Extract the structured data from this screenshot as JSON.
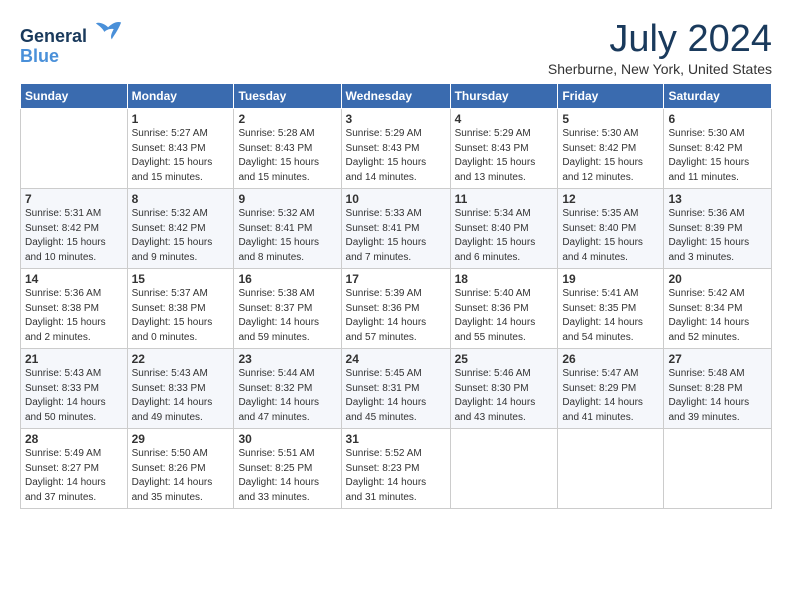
{
  "header": {
    "logo_line1": "General",
    "logo_line2": "Blue",
    "month_title": "July 2024",
    "location": "Sherburne, New York, United States"
  },
  "weekdays": [
    "Sunday",
    "Monday",
    "Tuesday",
    "Wednesday",
    "Thursday",
    "Friday",
    "Saturday"
  ],
  "weeks": [
    [
      {
        "day": "",
        "info": ""
      },
      {
        "day": "1",
        "info": "Sunrise: 5:27 AM\nSunset: 8:43 PM\nDaylight: 15 hours\nand 15 minutes."
      },
      {
        "day": "2",
        "info": "Sunrise: 5:28 AM\nSunset: 8:43 PM\nDaylight: 15 hours\nand 15 minutes."
      },
      {
        "day": "3",
        "info": "Sunrise: 5:29 AM\nSunset: 8:43 PM\nDaylight: 15 hours\nand 14 minutes."
      },
      {
        "day": "4",
        "info": "Sunrise: 5:29 AM\nSunset: 8:43 PM\nDaylight: 15 hours\nand 13 minutes."
      },
      {
        "day": "5",
        "info": "Sunrise: 5:30 AM\nSunset: 8:42 PM\nDaylight: 15 hours\nand 12 minutes."
      },
      {
        "day": "6",
        "info": "Sunrise: 5:30 AM\nSunset: 8:42 PM\nDaylight: 15 hours\nand 11 minutes."
      }
    ],
    [
      {
        "day": "7",
        "info": "Sunrise: 5:31 AM\nSunset: 8:42 PM\nDaylight: 15 hours\nand 10 minutes."
      },
      {
        "day": "8",
        "info": "Sunrise: 5:32 AM\nSunset: 8:42 PM\nDaylight: 15 hours\nand 9 minutes."
      },
      {
        "day": "9",
        "info": "Sunrise: 5:32 AM\nSunset: 8:41 PM\nDaylight: 15 hours\nand 8 minutes."
      },
      {
        "day": "10",
        "info": "Sunrise: 5:33 AM\nSunset: 8:41 PM\nDaylight: 15 hours\nand 7 minutes."
      },
      {
        "day": "11",
        "info": "Sunrise: 5:34 AM\nSunset: 8:40 PM\nDaylight: 15 hours\nand 6 minutes."
      },
      {
        "day": "12",
        "info": "Sunrise: 5:35 AM\nSunset: 8:40 PM\nDaylight: 15 hours\nand 4 minutes."
      },
      {
        "day": "13",
        "info": "Sunrise: 5:36 AM\nSunset: 8:39 PM\nDaylight: 15 hours\nand 3 minutes."
      }
    ],
    [
      {
        "day": "14",
        "info": "Sunrise: 5:36 AM\nSunset: 8:38 PM\nDaylight: 15 hours\nand 2 minutes."
      },
      {
        "day": "15",
        "info": "Sunrise: 5:37 AM\nSunset: 8:38 PM\nDaylight: 15 hours\nand 0 minutes."
      },
      {
        "day": "16",
        "info": "Sunrise: 5:38 AM\nSunset: 8:37 PM\nDaylight: 14 hours\nand 59 minutes."
      },
      {
        "day": "17",
        "info": "Sunrise: 5:39 AM\nSunset: 8:36 PM\nDaylight: 14 hours\nand 57 minutes."
      },
      {
        "day": "18",
        "info": "Sunrise: 5:40 AM\nSunset: 8:36 PM\nDaylight: 14 hours\nand 55 minutes."
      },
      {
        "day": "19",
        "info": "Sunrise: 5:41 AM\nSunset: 8:35 PM\nDaylight: 14 hours\nand 54 minutes."
      },
      {
        "day": "20",
        "info": "Sunrise: 5:42 AM\nSunset: 8:34 PM\nDaylight: 14 hours\nand 52 minutes."
      }
    ],
    [
      {
        "day": "21",
        "info": "Sunrise: 5:43 AM\nSunset: 8:33 PM\nDaylight: 14 hours\nand 50 minutes."
      },
      {
        "day": "22",
        "info": "Sunrise: 5:43 AM\nSunset: 8:33 PM\nDaylight: 14 hours\nand 49 minutes."
      },
      {
        "day": "23",
        "info": "Sunrise: 5:44 AM\nSunset: 8:32 PM\nDaylight: 14 hours\nand 47 minutes."
      },
      {
        "day": "24",
        "info": "Sunrise: 5:45 AM\nSunset: 8:31 PM\nDaylight: 14 hours\nand 45 minutes."
      },
      {
        "day": "25",
        "info": "Sunrise: 5:46 AM\nSunset: 8:30 PM\nDaylight: 14 hours\nand 43 minutes."
      },
      {
        "day": "26",
        "info": "Sunrise: 5:47 AM\nSunset: 8:29 PM\nDaylight: 14 hours\nand 41 minutes."
      },
      {
        "day": "27",
        "info": "Sunrise: 5:48 AM\nSunset: 8:28 PM\nDaylight: 14 hours\nand 39 minutes."
      }
    ],
    [
      {
        "day": "28",
        "info": "Sunrise: 5:49 AM\nSunset: 8:27 PM\nDaylight: 14 hours\nand 37 minutes."
      },
      {
        "day": "29",
        "info": "Sunrise: 5:50 AM\nSunset: 8:26 PM\nDaylight: 14 hours\nand 35 minutes."
      },
      {
        "day": "30",
        "info": "Sunrise: 5:51 AM\nSunset: 8:25 PM\nDaylight: 14 hours\nand 33 minutes."
      },
      {
        "day": "31",
        "info": "Sunrise: 5:52 AM\nSunset: 8:23 PM\nDaylight: 14 hours\nand 31 minutes."
      },
      {
        "day": "",
        "info": ""
      },
      {
        "day": "",
        "info": ""
      },
      {
        "day": "",
        "info": ""
      }
    ]
  ]
}
